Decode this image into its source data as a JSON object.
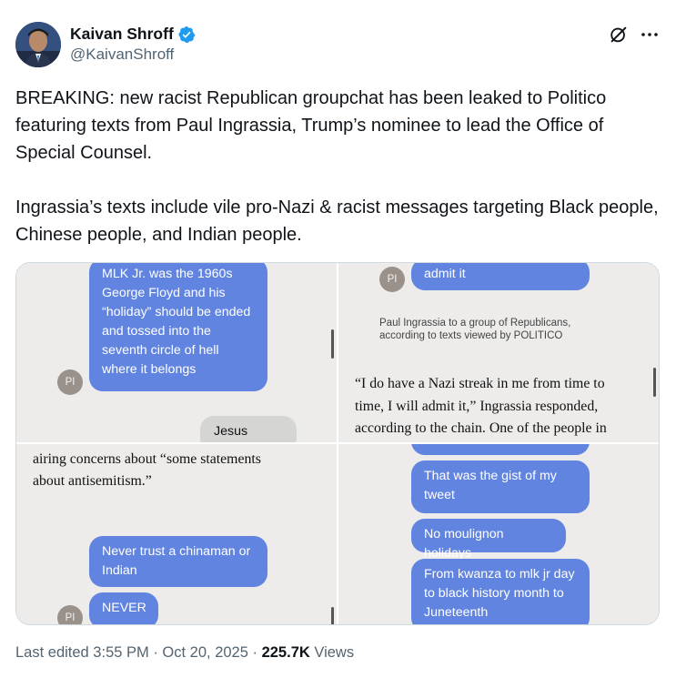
{
  "author": {
    "display_name": "Kaivan Shroff",
    "handle": "@KaivanShroff",
    "verified": true,
    "avatar_icon": "avatar-photo"
  },
  "icons": {
    "verified": "verified-badge-icon",
    "grok": "grok-icon",
    "more": "more-icon"
  },
  "tweet": {
    "text": "BREAKING: new racist Republican groupchat has been leaked to Politico featuring texts from Paul Ingrassia, Trump’s nominee to lead the Office of Special Counsel.\n\nIngrassia’s texts include vile pro-Nazi & racist messages targeting Black people, Chinese people, and Indian people."
  },
  "media": {
    "panel1": {
      "bubble": "MLK Jr. was the 1960s George Floyd and his “holiday” should be ended and tossed into the seventh circle of hell where it belongs",
      "avatar": "PI",
      "reply": "Jesus Christ"
    },
    "panel2": {
      "bubble": "admit it",
      "avatar": "PI",
      "caption_line1": "Paul Ingrassia to a group of Republicans,",
      "caption_line2": "according to texts viewed by POLITICO",
      "article_line1": "“I do have a Nazi streak in me from time to",
      "article_line2": "time, I will admit it,” Ingrassia responded,",
      "article_line3": "according to the chain. One of the people in"
    },
    "panel3": {
      "article_line1": "airing concerns about “some statements",
      "article_line2": "about antisemitism.”",
      "bubble1": "Never trust a chinaman or Indian",
      "bubble2": "NEVER",
      "avatar": "PI"
    },
    "panel4": {
      "bubble1": "That was the gist of my tweet",
      "bubble2": "No moulignon holidays",
      "bubble3": "From kwanza to mlk jr day to black history month to Juneteenth"
    }
  },
  "meta": {
    "last_edited": "Last edited 3:55 PM · Oct 20, 2025 · ",
    "views_count": "225.7K",
    "views_label": " Views"
  },
  "colors": {
    "imessage_blue": "#6184e0",
    "verified_blue": "#1d9bf0",
    "secondary_text": "#536471"
  }
}
